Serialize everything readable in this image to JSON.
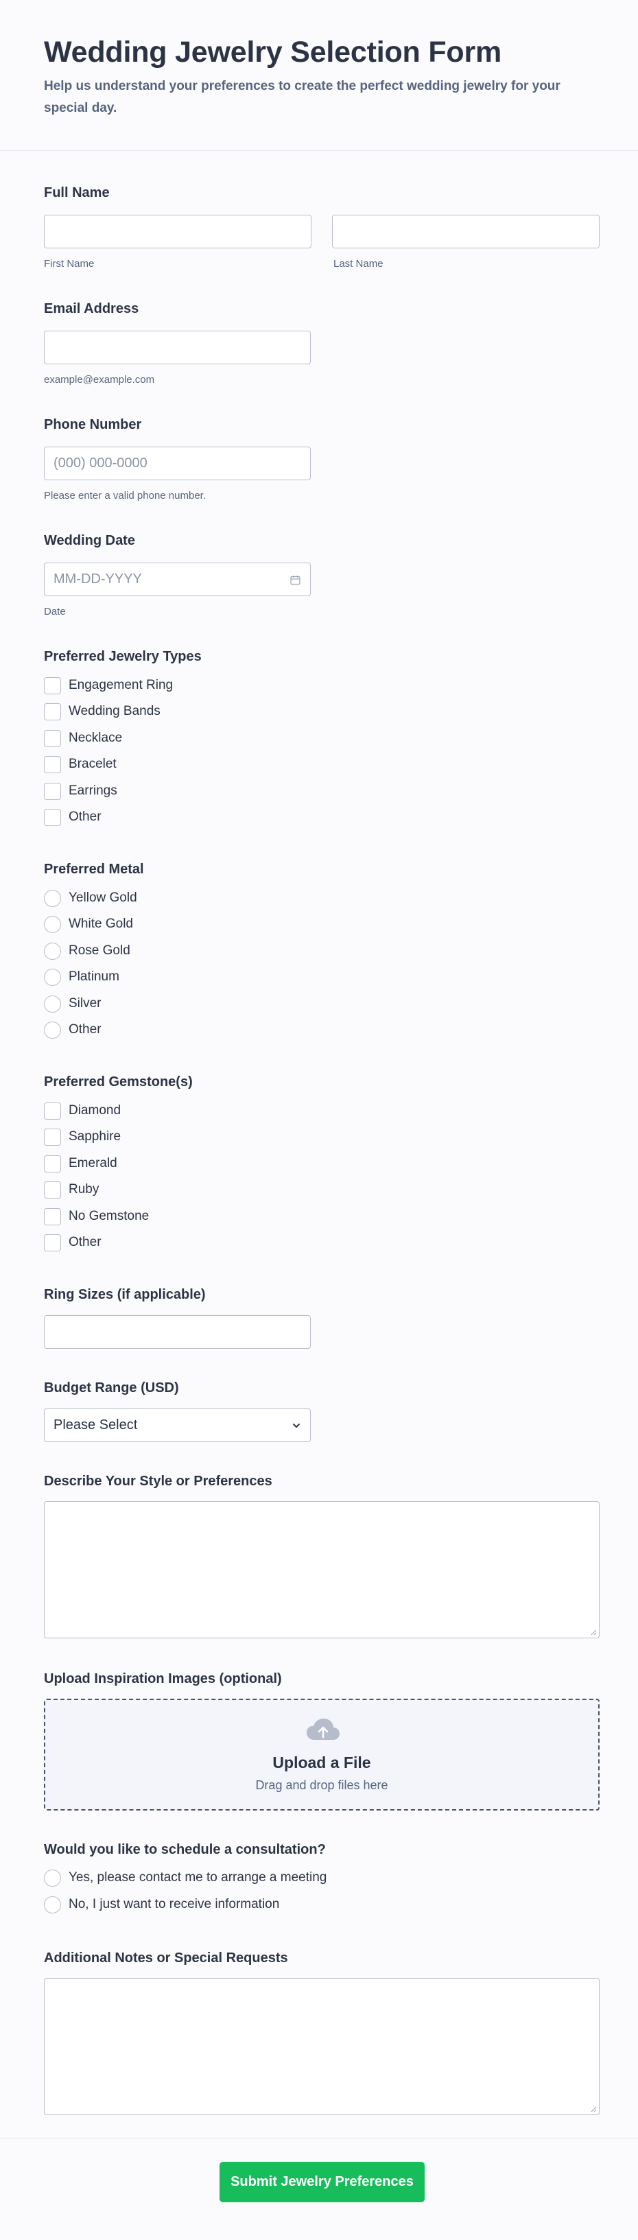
{
  "header": {
    "title": "Wedding Jewelry Selection Form",
    "subtitle": "Help us understand your preferences to create the perfect wedding jewelry for your special day."
  },
  "full_name": {
    "label": "Full Name",
    "first_sublabel": "First Name",
    "last_sublabel": "Last Name"
  },
  "email": {
    "label": "Email Address",
    "sublabel": "example@example.com"
  },
  "phone": {
    "label": "Phone Number",
    "placeholder": "(000) 000-0000",
    "sublabel": "Please enter a valid phone number."
  },
  "wedding_date": {
    "label": "Wedding Date",
    "placeholder": "MM-DD-YYYY",
    "sublabel": "Date",
    "icon": "calendar-icon"
  },
  "jewelry_types": {
    "label": "Preferred Jewelry Types",
    "options": [
      "Engagement Ring",
      "Wedding Bands",
      "Necklace",
      "Bracelet",
      "Earrings",
      "Other"
    ]
  },
  "metal": {
    "label": "Preferred Metal",
    "options": [
      "Yellow Gold",
      "White Gold",
      "Rose Gold",
      "Platinum",
      "Silver",
      "Other"
    ]
  },
  "gemstones": {
    "label": "Preferred Gemstone(s)",
    "options": [
      "Diamond",
      "Sapphire",
      "Emerald",
      "Ruby",
      "No Gemstone",
      "Other"
    ]
  },
  "ring_sizes": {
    "label": "Ring Sizes (if applicable)"
  },
  "budget": {
    "label": "Budget Range (USD)",
    "selected": "Please Select",
    "icon": "chevron-down-icon"
  },
  "style": {
    "label": "Describe Your Style or Preferences"
  },
  "upload": {
    "label": "Upload Inspiration Images (optional)",
    "title": "Upload a File",
    "subtitle": "Drag and drop files here",
    "icon": "cloud-upload-icon"
  },
  "consultation": {
    "label": "Would you like to schedule a consultation?",
    "options": [
      "Yes, please contact me to arrange a meeting",
      "No, I just want to receive information"
    ]
  },
  "notes": {
    "label": "Additional Notes or Special Requests"
  },
  "submit": {
    "label": "Submit Jewelry Preferences"
  },
  "colors": {
    "accent": "#18bd5b",
    "text": "#2c3345",
    "muted": "#57647e",
    "border": "#b8bdc9"
  }
}
